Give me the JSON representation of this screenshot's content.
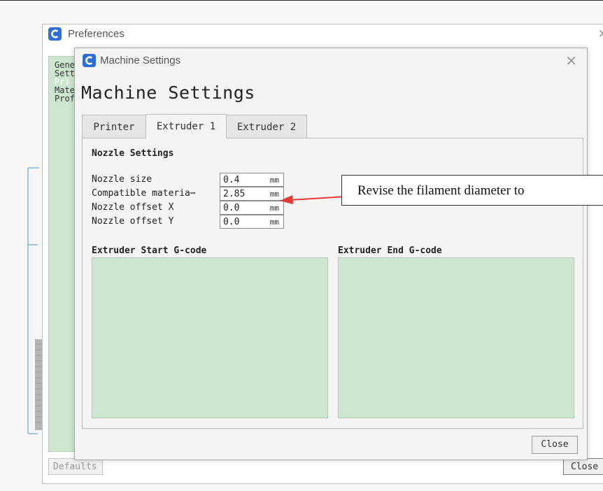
{
  "preferences": {
    "title": "Preferences",
    "sidebar_items": [
      "Gene",
      "Sett",
      "Pri",
      "Mate",
      "Prof"
    ],
    "defaults_label": "Defaults",
    "close_label": "Close"
  },
  "dialog": {
    "title": "Machine Settings",
    "heading": "Machine Settings",
    "tabs": [
      "Printer",
      "Extruder 1",
      "Extruder 2"
    ],
    "active_tab": "Extruder 1",
    "nozzle_section": {
      "title": "Nozzle Settings",
      "rows": [
        {
          "label": "Nozzle size",
          "value": "0.4",
          "unit": "mm"
        },
        {
          "label": "Compatible materia⋯",
          "value": "2.85",
          "unit": "mm"
        },
        {
          "label": "Nozzle offset X",
          "value": "0.0",
          "unit": "mm"
        },
        {
          "label": "Nozzle offset Y",
          "value": "0.0",
          "unit": "mm"
        }
      ]
    },
    "start_gcode_label": "Extruder Start G-code",
    "end_gcode_label": "Extruder End G-code",
    "close_label": "Close"
  },
  "annotation": {
    "text": "Revise the filament diameter to",
    "arrow_color": "#e53935"
  },
  "colors": {
    "accent": "#2d6fd6",
    "gcode_bg": "#cde6cf"
  }
}
